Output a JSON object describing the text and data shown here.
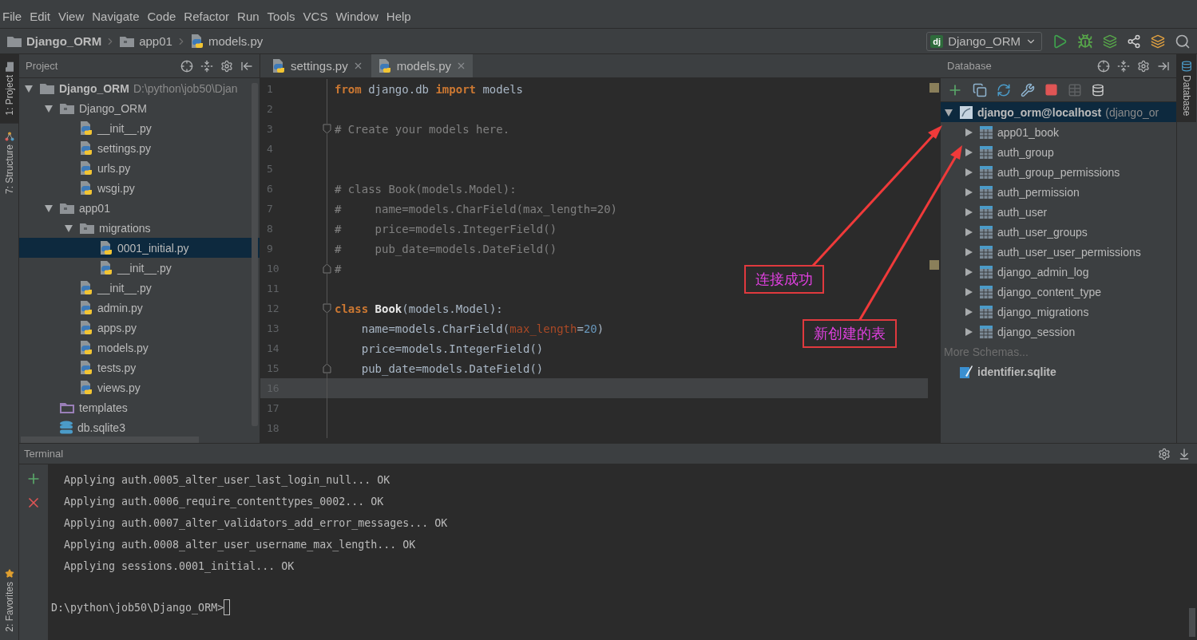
{
  "menu": [
    "File",
    "Edit",
    "View",
    "Navigate",
    "Code",
    "Refactor",
    "Run",
    "Tools",
    "VCS",
    "Window",
    "Help"
  ],
  "breadcrumbs": [
    {
      "label": "Django_ORM",
      "kind": "project"
    },
    {
      "label": "app01",
      "kind": "folder"
    },
    {
      "label": "models.py",
      "kind": "python"
    }
  ],
  "run_config": {
    "label": "Django_ORM",
    "badge": "dj"
  },
  "left_tool_tabs": [
    {
      "label": "1: Project",
      "kind": "project",
      "selected": true
    },
    {
      "label": "7: Structure",
      "kind": "structure",
      "selected": false
    }
  ],
  "favorites_tab": {
    "label": "2: Favorites"
  },
  "project": {
    "title": "Project",
    "tree": [
      {
        "label": "Django_ORM",
        "path": "D:\\python\\job50\\Djan",
        "kind": "project",
        "expanded": true,
        "selected": false,
        "children": [
          {
            "label": "Django_ORM",
            "kind": "folder",
            "expanded": true,
            "selected": false,
            "children": [
              {
                "label": "__init__.py",
                "kind": "python",
                "selected": false
              },
              {
                "label": "settings.py",
                "kind": "python",
                "selected": false
              },
              {
                "label": "urls.py",
                "kind": "python",
                "selected": false
              },
              {
                "label": "wsgi.py",
                "kind": "python",
                "selected": false
              }
            ]
          },
          {
            "label": "app01",
            "kind": "folder",
            "expanded": true,
            "selected": false,
            "children": [
              {
                "label": "migrations",
                "kind": "folder",
                "expanded": true,
                "selected": false,
                "children": [
                  {
                    "label": "0001_initial.py",
                    "kind": "python",
                    "selected": true
                  },
                  {
                    "label": "__init__.py",
                    "kind": "python",
                    "selected": false
                  }
                ]
              },
              {
                "label": "__init__.py",
                "kind": "python",
                "selected": false
              },
              {
                "label": "admin.py",
                "kind": "python",
                "selected": false
              },
              {
                "label": "apps.py",
                "kind": "python",
                "selected": false
              },
              {
                "label": "models.py",
                "kind": "python",
                "selected": false
              },
              {
                "label": "tests.py",
                "kind": "python",
                "selected": false
              },
              {
                "label": "views.py",
                "kind": "python",
                "selected": false
              }
            ]
          },
          {
            "label": "templates",
            "kind": "templates",
            "selected": false
          },
          {
            "label": "db.sqlite3",
            "kind": "sqlite",
            "selected": false
          }
        ]
      }
    ]
  },
  "editor": {
    "tabs": [
      {
        "label": "settings.py",
        "selected": false
      },
      {
        "label": "models.py",
        "selected": true
      }
    ],
    "lines": [
      {
        "number": "1",
        "current": false,
        "tokens": [
          {
            "kind": "kw",
            "text": "from"
          },
          {
            "kind": "plain",
            "text": " django.db "
          },
          {
            "kind": "kw",
            "text": "import"
          },
          {
            "kind": "plain",
            "text": " models"
          }
        ]
      },
      {
        "number": "2",
        "current": false
      },
      {
        "number": "3",
        "fold_start": true,
        "current": false,
        "tokens": [
          {
            "kind": "comment",
            "text": "# Create your models here."
          }
        ]
      },
      {
        "number": "4",
        "current": false
      },
      {
        "number": "5",
        "current": false
      },
      {
        "number": "6",
        "current": false,
        "tokens": [
          {
            "kind": "comment",
            "text": "# class Book(models.Model):"
          }
        ]
      },
      {
        "number": "7",
        "current": false,
        "tokens": [
          {
            "kind": "comment",
            "text": "#     name=models.CharField(max_length=20)"
          }
        ]
      },
      {
        "number": "8",
        "current": false,
        "tokens": [
          {
            "kind": "comment",
            "text": "#     price=models.IntegerField()"
          }
        ]
      },
      {
        "number": "9",
        "current": false,
        "tokens": [
          {
            "kind": "comment",
            "text": "#     pub_date=models.DateField()"
          }
        ]
      },
      {
        "number": "10",
        "fold_end": true,
        "current": false,
        "tokens": [
          {
            "kind": "comment",
            "text": "#"
          }
        ]
      },
      {
        "number": "11",
        "current": false
      },
      {
        "number": "12",
        "fold_start": true,
        "current": false,
        "tokens": [
          {
            "kind": "kw",
            "text": "class"
          },
          {
            "kind": "cls",
            "text": " Book"
          },
          {
            "kind": "plain",
            "text": "(models.Model):"
          }
        ]
      },
      {
        "number": "13",
        "current": false,
        "tokens": [
          {
            "kind": "plain",
            "text": "    name=models.CharField("
          },
          {
            "kind": "param",
            "text": "max_length"
          },
          {
            "kind": "plain",
            "text": "="
          },
          {
            "kind": "num",
            "text": "20"
          },
          {
            "kind": "plain",
            "text": ")"
          }
        ]
      },
      {
        "number": "14",
        "current": false,
        "tokens": [
          {
            "kind": "plain",
            "text": "    price=models.IntegerField()"
          }
        ]
      },
      {
        "number": "15",
        "fold_end": true,
        "current": false,
        "tokens": [
          {
            "kind": "plain",
            "text": "    pub_date=models.DateField()"
          }
        ]
      },
      {
        "number": "16",
        "current": true
      },
      {
        "number": "17",
        "current": false
      },
      {
        "number": "18",
        "current": false
      }
    ]
  },
  "database": {
    "title": "Database",
    "tree": [
      {
        "label": "django_orm@localhost",
        "detail": "(django_or",
        "kind": "datasource",
        "expanded": true,
        "selected": true,
        "children": [
          {
            "label": "app01_book",
            "kind": "table",
            "expanded": false,
            "selected": false
          },
          {
            "label": "auth_group",
            "kind": "table",
            "expanded": false,
            "selected": false
          },
          {
            "label": "auth_group_permissions",
            "kind": "table",
            "expanded": false,
            "selected": false
          },
          {
            "label": "auth_permission",
            "kind": "table",
            "expanded": false,
            "selected": false
          },
          {
            "label": "auth_user",
            "kind": "table",
            "expanded": false,
            "selected": false
          },
          {
            "label": "auth_user_groups",
            "kind": "table",
            "expanded": false,
            "selected": false
          },
          {
            "label": "auth_user_user_permissions",
            "kind": "table",
            "expanded": false,
            "selected": false
          },
          {
            "label": "django_admin_log",
            "kind": "table",
            "expanded": false,
            "selected": false
          },
          {
            "label": "django_content_type",
            "kind": "table",
            "expanded": false,
            "selected": false
          },
          {
            "label": "django_migrations",
            "kind": "table",
            "expanded": false,
            "selected": false
          },
          {
            "label": "django_session",
            "kind": "table",
            "expanded": false,
            "selected": false
          },
          {
            "label": "More Schemas...",
            "kind": "more",
            "selected": false
          }
        ]
      },
      {
        "label": "identifier.sqlite",
        "kind": "sqlite-file",
        "selected": false
      }
    ]
  },
  "right_tool_tab": {
    "label": "Database"
  },
  "terminal": {
    "title": "Terminal",
    "lines": [
      "Applying auth.0005_alter_user_last_login_null... OK",
      "Applying auth.0006_require_contenttypes_0002... OK",
      "Applying auth.0007_alter_validators_add_error_messages... OK",
      "Applying auth.0008_alter_user_username_max_length... OK",
      "Applying sessions.0001_initial... OK"
    ],
    "prompt": "D:\\python\\job50\\Django_ORM>"
  },
  "annotations": [
    {
      "text": "连接成功"
    },
    {
      "text": "新创建的表"
    }
  ]
}
